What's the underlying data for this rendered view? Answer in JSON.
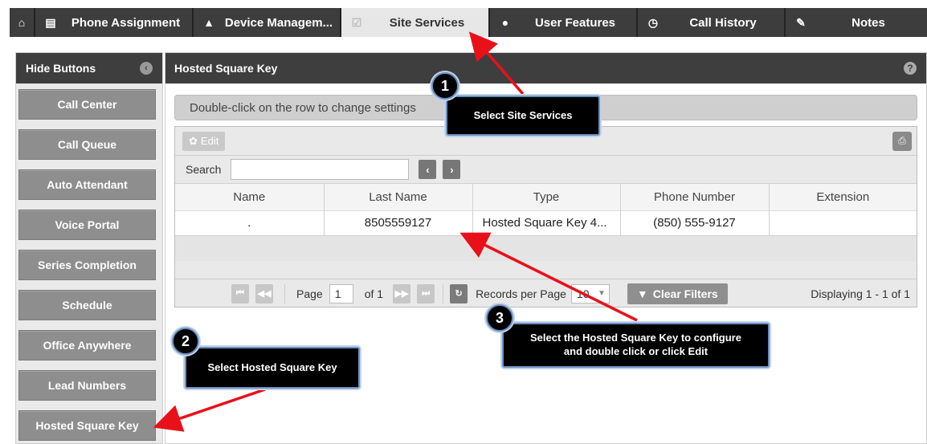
{
  "tabs": [
    {
      "name": "home",
      "icon": "home-icon",
      "glyph": "⌂",
      "label": ""
    },
    {
      "name": "phone-assignment",
      "icon": "list-icon",
      "glyph": "▤",
      "label": "Phone Assignment"
    },
    {
      "name": "device-management",
      "icon": "bell-icon",
      "glyph": "▲",
      "label": "Device Managem..."
    },
    {
      "name": "site-services",
      "icon": "check-icon",
      "glyph": "☑",
      "label": "Site Services"
    },
    {
      "name": "user-features",
      "icon": "user-icon",
      "glyph": "●",
      "label": "User Features"
    },
    {
      "name": "call-history",
      "icon": "clock-icon",
      "glyph": "◷",
      "label": "Call History"
    },
    {
      "name": "notes",
      "icon": "pencil-icon",
      "glyph": "✎",
      "label": "Notes"
    }
  ],
  "sidebar": {
    "header": "Hide Buttons",
    "items": [
      "Call Center",
      "Call Queue",
      "Auto Attendant",
      "Voice Portal",
      "Series Completion",
      "Schedule",
      "Office Anywhere",
      "Lead Numbers",
      "Hosted Square Key"
    ]
  },
  "main": {
    "title": "Hosted Square Key",
    "help": "?",
    "notice": "Double-click on the row to change settings",
    "edit_label": "Edit",
    "search_label": "Search",
    "search_value": "",
    "columns": [
      "Name",
      "Last Name",
      "Type",
      "Phone Number",
      "Extension"
    ],
    "rows": [
      [
        ".",
        "8505559127",
        "Hosted Square Key 4...",
        "(850) 555-9127",
        ""
      ]
    ]
  },
  "pager": {
    "page_label": "Page",
    "page_value": "1",
    "of_label": "of 1",
    "records_label": "Records per Page",
    "records_value": "10",
    "clear_filters": "Clear Filters",
    "displaying": "Displaying 1 - 1 of 1"
  },
  "callouts": {
    "step1_num": "1",
    "step1_text": "Select Site Services",
    "step2_num": "2",
    "step2_text": "Select Hosted Square Key",
    "step3_num": "3",
    "step3_text": "Select the Hosted Square Key to configure and double click or click Edit"
  },
  "colors": {
    "header_bg": "#3e3e3e",
    "button_gray": "#8e8e8e",
    "arrow_red": "#e8111a",
    "callout_border": "#6a8fbf"
  }
}
